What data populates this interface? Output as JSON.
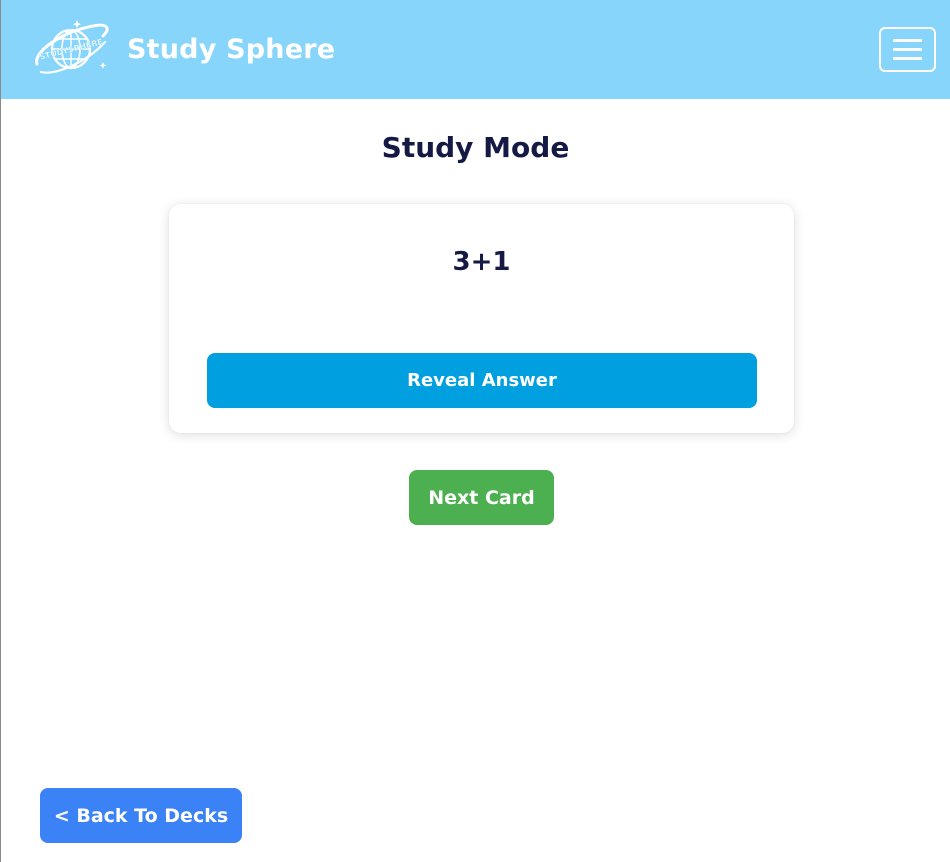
{
  "header": {
    "brand": "Study Sphere",
    "logo_icon": "study-sphere-globe-logo",
    "logo_text": "STUDYSPHERE",
    "menu_icon": "hamburger-menu-icon",
    "background_color": "#87d5fb"
  },
  "main": {
    "title": "Study Mode",
    "card": {
      "question": "3+1",
      "reveal_label": "Reveal Answer"
    },
    "next_label": "Next Card",
    "back_label": "< Back To Decks"
  },
  "colors": {
    "title_text": "#141a44",
    "reveal_button": "#009fe0",
    "next_button": "#4caf50",
    "back_button": "#3b82f6"
  }
}
